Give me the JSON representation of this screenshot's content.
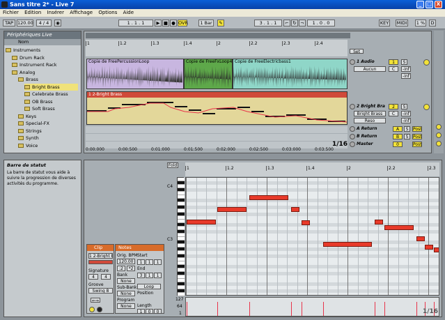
{
  "window": {
    "title": "Sans titre 2* - Live 7",
    "min": "_",
    "max": "□",
    "close": "X"
  },
  "menu": [
    "Fichier",
    "Edition",
    "Insérer",
    "Affichage",
    "Options",
    "Aide"
  ],
  "transport": {
    "tap": "TAP",
    "tempo": "120.00",
    "sig": "4 / 4",
    "pos": "1 . 1 . 1",
    "ovr": "OVR",
    "bar": "1 Bar",
    "pos2": "3 . 1 . 1",
    "loop_len": "1 . 0 . 0",
    "key": "KEY",
    "midi": "MIDI",
    "cpu": "1 %",
    "d": "D"
  },
  "browser": {
    "title": "Périphériques Live",
    "col": "Nom",
    "items": [
      {
        "label": "Instruments",
        "indent": 0
      },
      {
        "label": "Drum Rack",
        "indent": 1
      },
      {
        "label": "Instrument Rack",
        "indent": 1
      },
      {
        "label": "Analog",
        "indent": 1
      },
      {
        "label": "Brass",
        "indent": 2
      },
      {
        "label": "Bright Brass",
        "indent": 3,
        "sel": true
      },
      {
        "label": "Celebrate Brass",
        "indent": 3
      },
      {
        "label": "OB Brass",
        "indent": 3
      },
      {
        "label": "Soft Brass",
        "indent": 3
      },
      {
        "label": "Keys",
        "indent": 2
      },
      {
        "label": "Special-FX",
        "indent": 2
      },
      {
        "label": "Strings",
        "indent": 2
      },
      {
        "label": "Synth",
        "indent": 2
      },
      {
        "label": "Voice",
        "indent": 2
      }
    ]
  },
  "info": {
    "title": "Barre de statut",
    "text": "La barre de statut vous aide à suivre la progression de diverses activités du programme."
  },
  "arrangement": {
    "ruler": [
      "1",
      "1.2",
      "1.3",
      "1.4",
      "2",
      "2.2",
      "2.3",
      "2.4"
    ],
    "clips_audio": [
      "Copie de FreePercussionLoop",
      "Copie de FreeFxLoop4",
      "Copie de FreeElectricbass1"
    ],
    "midi_clip": "1 2-Bright Brass",
    "times": [
      "0:00:000",
      "0:00:500",
      "0:01:000",
      "0:01:500",
      "0:02:000",
      "0:02:500",
      "0:03:000",
      "0:03:500"
    ],
    "zoom": "1/16",
    "tracks": [
      {
        "name": "1 Audio",
        "num": "1",
        "s": "S",
        "in": "Aucun",
        "mon": "C",
        "send": "-inf"
      },
      {
        "name": "2 Bright Bra",
        "num": "2",
        "s": "S",
        "in": "Bright Brass",
        "in2": "Reso",
        "mon": "C",
        "send": "-inf"
      },
      {
        "name": "A Return",
        "num": "A",
        "s": "S",
        "post": "Post"
      },
      {
        "name": "B Return",
        "num": "B",
        "s": "S",
        "post": "Post"
      },
      {
        "name": "Master",
        "num": "0",
        "post": "Post"
      }
    ],
    "set": "Set"
  },
  "clip": {
    "title": "Clip",
    "notes": "Notes",
    "name": "1 2-Bright Br",
    "sig_label": "Signature",
    "sig_n": "4",
    "sig_d": "4",
    "groove_label": "Groove",
    "groove": "Swing 8",
    "orig_bpm": "Orig. BPM",
    "bpm": "120.00",
    "half": ":2",
    "dbl": "*2",
    "bank": "Bank",
    "none": "None",
    "subbank": "Sub-Bank",
    "program": "Program",
    "start": "Start",
    "end": "End",
    "loop": "Loop",
    "position": "Position",
    "length": "Length",
    "start_v": [
      "1",
      "1",
      "1"
    ],
    "end_v": [
      "3",
      "1",
      "1"
    ],
    "len_v": [
      "1",
      "0",
      "0"
    ],
    "set": "Set"
  },
  "editor": {
    "fold": "Fold",
    "c4": "C4",
    "c3": "C3",
    "ruler": [
      "1",
      "1.2",
      "1.3",
      "1.4",
      "2",
      "2.2",
      "2.3"
    ],
    "vel_max": "127",
    "vel_mid": "64",
    "vel_min": "1",
    "zoom": "1/16"
  }
}
